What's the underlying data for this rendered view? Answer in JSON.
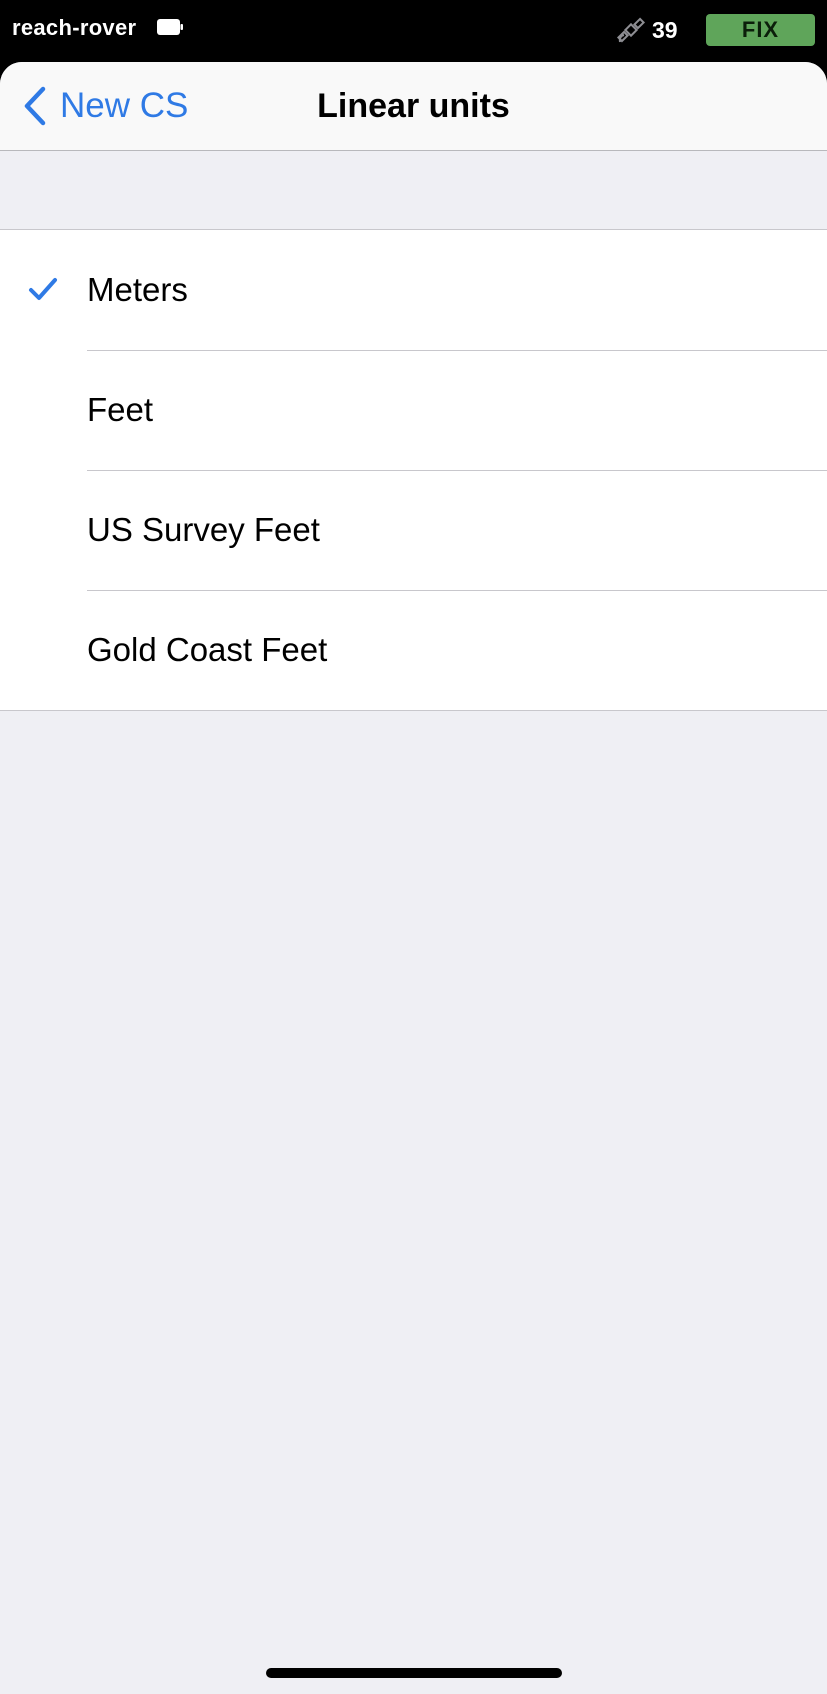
{
  "status_bar": {
    "device_name": "reach-rover",
    "battery_icon": "battery-icon",
    "satellite_icon": "satellite-icon",
    "satellite_count": "39",
    "fix_status": "FIX",
    "fix_color": "#5fa55a"
  },
  "nav": {
    "back_label": "New CS",
    "back_icon": "chevron-left-icon",
    "title": "Linear units"
  },
  "units": {
    "selected": "Meters",
    "items": [
      {
        "label": "Meters",
        "selected": true
      },
      {
        "label": "Feet",
        "selected": false
      },
      {
        "label": "US Survey Feet",
        "selected": false
      },
      {
        "label": "Gold Coast Feet",
        "selected": false
      }
    ]
  },
  "colors": {
    "accent": "#2f7ae5",
    "background": "#efeff4",
    "cell": "#ffffff",
    "separator": "#c8c7cc"
  }
}
